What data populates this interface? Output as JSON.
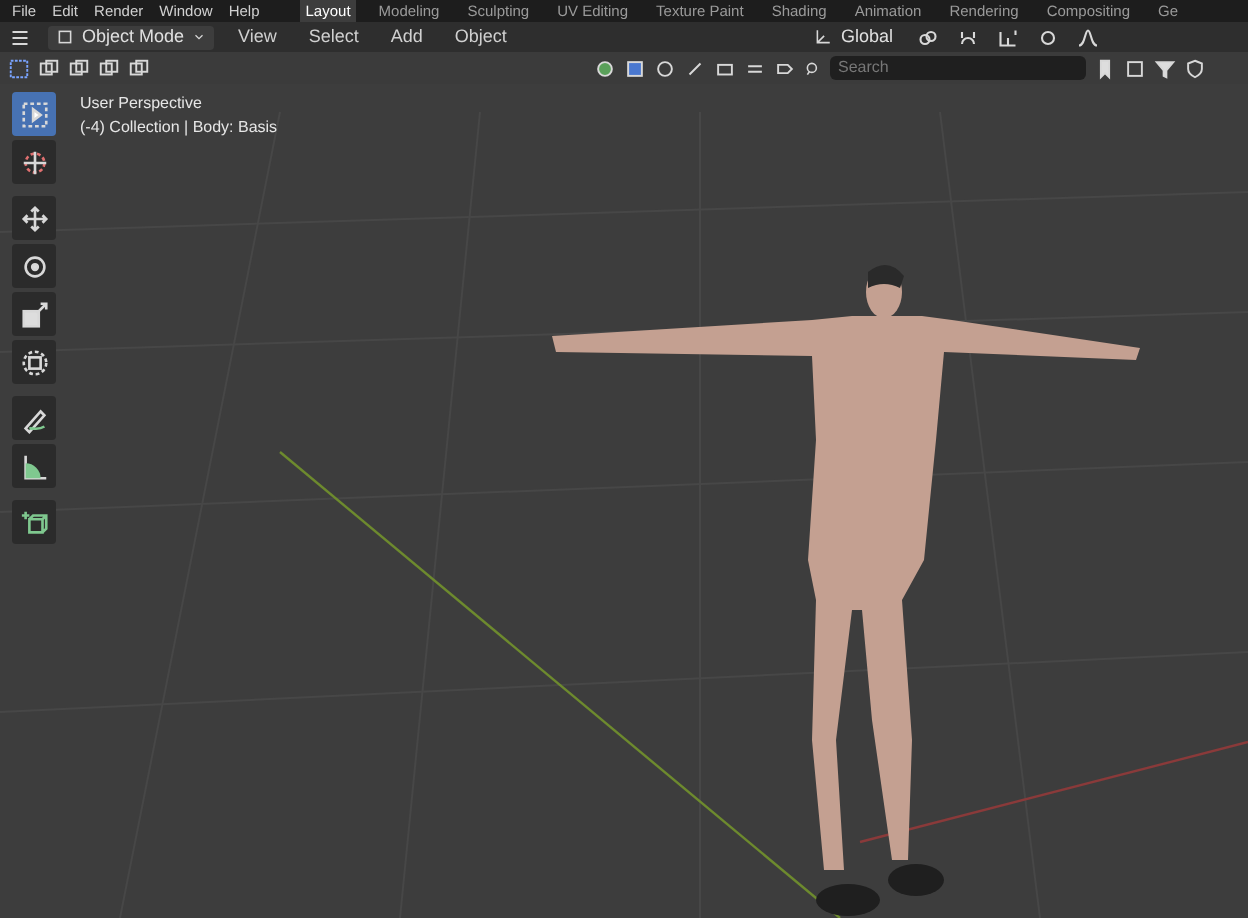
{
  "menu": [
    "File",
    "Edit",
    "Render",
    "Window",
    "Help"
  ],
  "workspaces": [
    {
      "label": "Layout",
      "selected": true
    },
    {
      "label": "Modeling",
      "selected": false
    },
    {
      "label": "Sculpting",
      "selected": false
    },
    {
      "label": "UV Editing",
      "selected": false
    },
    {
      "label": "Texture Paint",
      "selected": false
    },
    {
      "label": "Shading",
      "selected": false
    },
    {
      "label": "Animation",
      "selected": false
    },
    {
      "label": "Rendering",
      "selected": false
    },
    {
      "label": "Compositing",
      "selected": false
    },
    {
      "label": "Ge",
      "selected": false
    }
  ],
  "header": {
    "mode": "Object Mode",
    "menus": [
      "View",
      "Select",
      "Add",
      "Object"
    ],
    "orientation": "Global"
  },
  "search": {
    "placeholder": "Search"
  },
  "tool_groups": [
    [
      {
        "kind": "select",
        "selected": true
      },
      {
        "kind": "cursor",
        "selected": false
      }
    ],
    [
      {
        "kind": "move",
        "selected": false
      },
      {
        "kind": "rotate",
        "selected": false
      },
      {
        "kind": "scale",
        "selected": false
      },
      {
        "kind": "transform",
        "selected": false
      }
    ],
    [
      {
        "kind": "annotate",
        "selected": false
      },
      {
        "kind": "measure",
        "selected": false
      }
    ],
    [
      {
        "kind": "add-cube",
        "selected": false
      }
    ]
  ],
  "overlay": [
    "User Perspective",
    "(-4) Collection | Body: Basis"
  ]
}
